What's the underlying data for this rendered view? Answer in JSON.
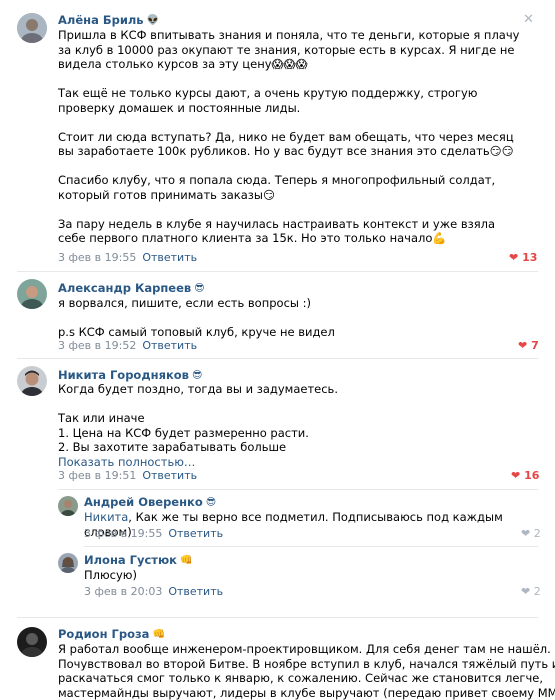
{
  "c1": {
    "author": "Алёна Бриль",
    "author_emoji": "👽",
    "p1": "Пришла в КСФ впитывать знания и поняла, что те деньги, которые я плачу за клуб в 10000 раз окупают те знания, которые есть в курсах. Я нигде не видела столько курсов за эту цену😱😱😱",
    "p2": "Так ещё не только курсы дают, а очень крутую поддержку, строгую проверку домашек и постоянные лиды.",
    "p3": "Стоит ли сюда вступать? Да, нико не будет вам обещать, что через месяц вы заработаете 100к рубликов. Но у вас будут все знания это сделать😏😏",
    "p4": "Спасибо клубу, что я попала сюда. Теперь я многопрофильный солдат, который готов принимать заказы😏",
    "p5": "За пару недель в клубе я научилась настраивать контекст и уже взяла себе первого платного клиента за 15к. Но это только начало💪",
    "date": "3 фев в 19:55",
    "reply": "Ответить",
    "likes": "13"
  },
  "c2": {
    "author": "Александр Карпеев",
    "author_emoji": "😎",
    "p1": "я ворвался, пишите, если есть вопросы :)",
    "p2": "p.s КСФ самый топовый клуб, круче не видел",
    "date": "3 фев в 19:52",
    "reply": "Ответить",
    "likes": "7"
  },
  "c3": {
    "author": "Никита Городняков",
    "author_emoji": "😎",
    "p1": "Когда будет поздно, тогда вы и задумаетесь.",
    "l1": "Так или иначе",
    "l2": "1. Цена на КСФ будет размеренно расти.",
    "l3": "2. Вы захотите зарабатывать больше",
    "show_more": "Показать полностью…",
    "date": "3 фев в 19:51",
    "reply": "Ответить",
    "likes": "16"
  },
  "c4": {
    "author": "Андрей Оверенко",
    "author_emoji": "😎",
    "mention": "Никита",
    "text": ", Как же ты верно все подметил. Подписываюсь под каждым словом)",
    "date": "3 фев в 19:55",
    "reply": "Ответить",
    "likes": "2"
  },
  "c5": {
    "author": "Илона Густюк",
    "author_emoji": "👊",
    "text": "Плюсую)",
    "date": "3 фев в 20:03",
    "reply": "Ответить",
    "likes": "2"
  },
  "c6": {
    "author": "Родион Гроза",
    "author_emoji": "👊",
    "l1": "Я работал вообще инженером-проектировщиком. Для себя денег там не нашёл.",
    "l2": "Почувствовал во второй Битве. В ноябре вступил в клуб, начался тяжёлый путь и",
    "l3": "раскачаться смог только к январю, к сожалению. Сейчас же становится легче,",
    "l4": "мастермайнды выручают, лидеры в клубе выручают (передаю привет своему ММ и"
  },
  "icons": {
    "close": "close-icon",
    "heart": "heart-icon"
  },
  "colors": {
    "link": "#2a5885",
    "meta": "#818c99",
    "like_active": "#e64646",
    "like_inactive": "#aeb7c2"
  }
}
